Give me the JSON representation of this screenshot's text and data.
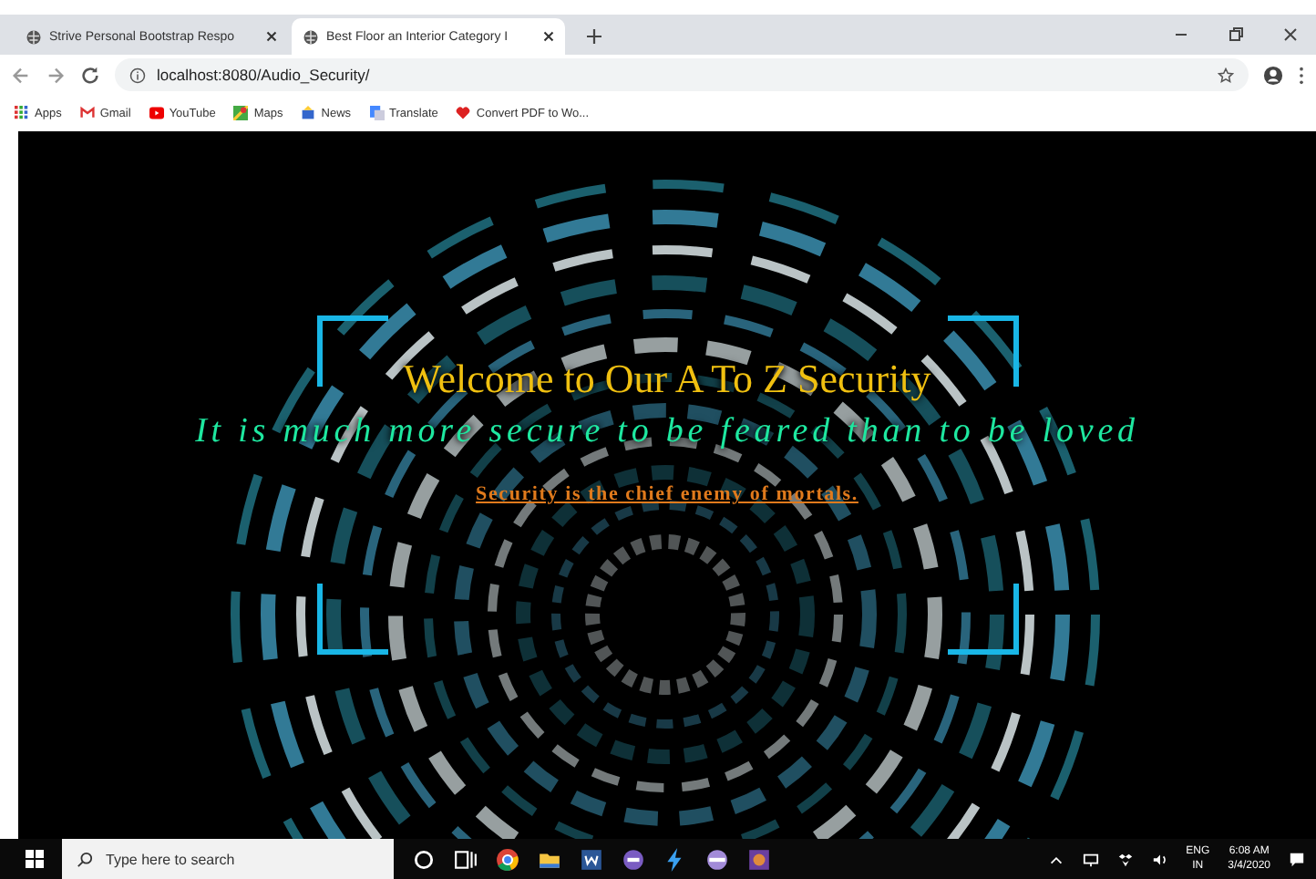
{
  "browser": {
    "tabs": [
      {
        "title": "Strive Personal Bootstrap Respo",
        "selected": false
      },
      {
        "title": "Best Floor an Interior Category I",
        "selected": true
      }
    ],
    "address": "localhost:8080/Audio_Security/",
    "bookmarks": [
      {
        "label": "Apps",
        "kind": "apps"
      },
      {
        "label": "Gmail",
        "kind": "gmail"
      },
      {
        "label": "YouTube",
        "kind": "youtube"
      },
      {
        "label": "Maps",
        "kind": "maps"
      },
      {
        "label": "News",
        "kind": "news"
      },
      {
        "label": "Translate",
        "kind": "translate"
      },
      {
        "label": "Convert PDF to Wo...",
        "kind": "pdf"
      }
    ]
  },
  "page": {
    "heading": "Welcome to Our A To Z Security",
    "tagline": "It is much more secure to be feared than to be loved",
    "link": "Security is the chief enemy of mortals."
  },
  "taskbar": {
    "search_placeholder": "Type here to search",
    "language": "ENG",
    "region": "IN",
    "time": "6:08 AM",
    "date": "3/4/2020"
  }
}
